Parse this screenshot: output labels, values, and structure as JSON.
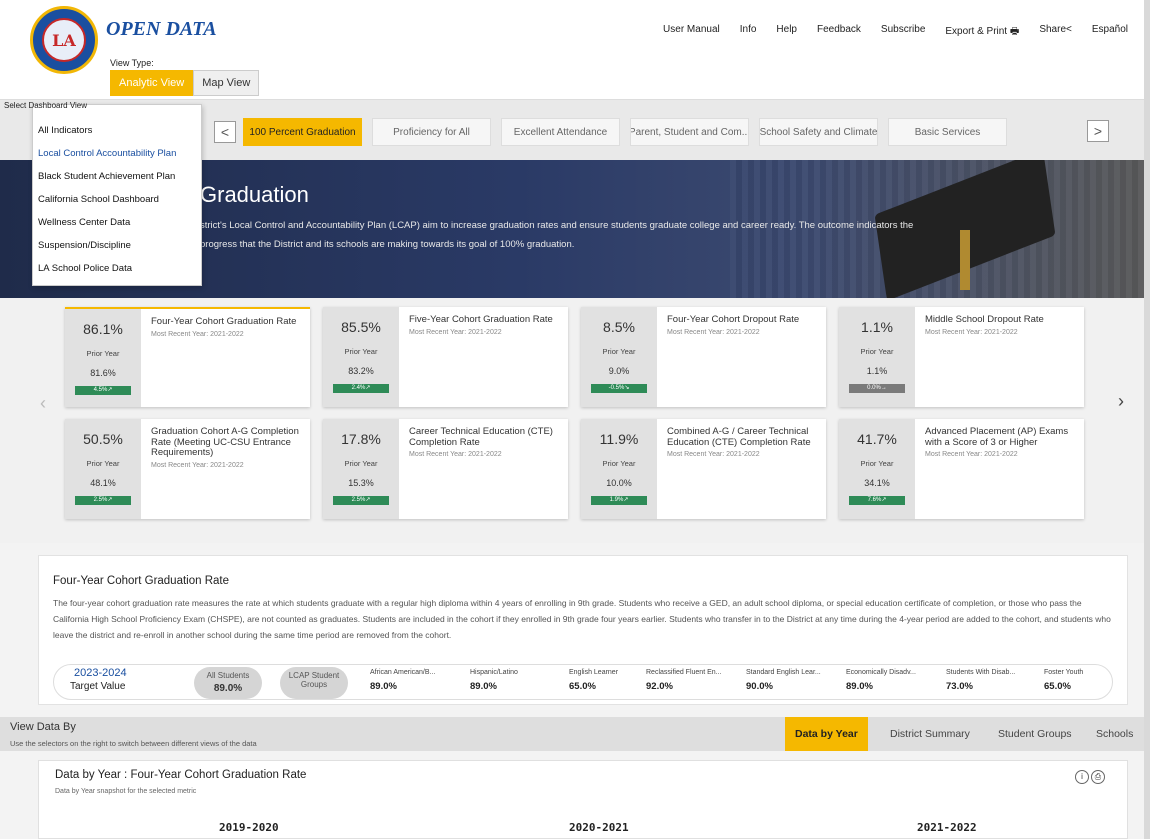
{
  "header": {
    "brand": "OPEN DATA",
    "logo_text": "LA",
    "nav": [
      "User Manual",
      "Info",
      "Help",
      "Feedback",
      "Subscribe",
      "Export & Print",
      "Share",
      "Español"
    ],
    "view_type_label": "View Type:",
    "view_tabs": [
      "Analytic View",
      "Map View"
    ]
  },
  "selector": {
    "label": "Select Dashboard View",
    "prev": "<",
    "next": ">",
    "tabs": [
      "100 Percent Graduation",
      "Proficiency for All",
      "Excellent Attendance",
      "Parent, Student and Com...",
      "School Safety and Climate",
      "Basic Services"
    ]
  },
  "dropdown": {
    "items": [
      "All Indicators",
      "Local Control Accountability Plan",
      "Black Student Achievement Plan",
      "California School Dashboard",
      "Wellness Center Data",
      "Suspension/Discipline",
      "LA School Police Data"
    ],
    "selected": "Local Control Accountability Plan"
  },
  "hero": {
    "title": "Graduation",
    "text": "strict's Local Control and Accountability Plan (LCAP) aim to increase graduation rates and ensure students graduate college and career ready. The outcome indicators the progress that the District and its schools are making towards its goal of 100% graduation."
  },
  "cards": [
    {
      "value": "86.1%",
      "prior_label": "Prior Year",
      "prior": "81.6%",
      "change": "4.5%↗",
      "title": "Four-Year Cohort Graduation Rate",
      "recent": "Most Recent Year: 2021-2022"
    },
    {
      "value": "85.5%",
      "prior_label": "Prior Year",
      "prior": "83.2%",
      "change": "2.4%↗",
      "title": "Five-Year Cohort Graduation Rate",
      "recent": "Most Recent Year: 2021-2022"
    },
    {
      "value": "8.5%",
      "prior_label": "Prior Year",
      "prior": "9.0%",
      "change": "-0.5%↘",
      "title": "Four-Year Cohort Dropout Rate",
      "recent": "Most Recent Year: 2021-2022"
    },
    {
      "value": "1.1%",
      "prior_label": "Prior Year",
      "prior": "1.1%",
      "change": "0.0%→",
      "title": "Middle School Dropout Rate",
      "recent": "Most Recent Year: 2021-2022"
    },
    {
      "value": "50.5%",
      "prior_label": "Prior Year",
      "prior": "48.1%",
      "change": "2.5%↗",
      "title": "Graduation Cohort A-G Completion Rate (Meeting UC-CSU Entrance Requirements)",
      "recent": "Most Recent Year: 2021-2022"
    },
    {
      "value": "17.8%",
      "prior_label": "Prior Year",
      "prior": "15.3%",
      "change": "2.5%↗",
      "title": "Career Technical Education (CTE) Completion Rate",
      "recent": "Most Recent Year: 2021-2022"
    },
    {
      "value": "11.9%",
      "prior_label": "Prior Year",
      "prior": "10.0%",
      "change": "1.9%↗",
      "title": "Combined A-G / Career Technical Education (CTE) Completion Rate",
      "recent": "Most Recent Year: 2021-2022"
    },
    {
      "value": "41.7%",
      "prior_label": "Prior Year",
      "prior": "34.1%",
      "change": "7.6%↗",
      "title": "Advanced Placement (AP) Exams with a Score of 3 or Higher",
      "recent": "Most Recent Year: 2021-2022"
    }
  ],
  "description": {
    "title": "Four-Year Cohort Graduation Rate",
    "text": "The four-year cohort graduation rate measures the rate at which students graduate with a regular high diploma within 4 years of enrolling in 9th grade. Students who receive a GED, an adult school diploma, or special education certificate of completion, or those who pass the California High School Proficiency Exam (CHSPE), are not counted as graduates. Students are included in the cohort if they enrolled in 9th grade four years earlier. Students who transfer in to the District at any time during the 4-year period are added to the cohort, and students who leave the district and re-enroll in another school during the same time period are removed from the cohort."
  },
  "target": {
    "year": "2023-2024",
    "label": "Target Value",
    "all_students_label": "All Students",
    "all_students_value": "89.0%",
    "lcap_label": "LCAP Student Groups",
    "groups": [
      {
        "name": "African American/B...",
        "value": "89.0%"
      },
      {
        "name": "Hispanic/Latino",
        "value": "89.0%"
      },
      {
        "name": "English Learner",
        "value": "65.0%"
      },
      {
        "name": "Reclassified Fluent En...",
        "value": "92.0%"
      },
      {
        "name": "Standard English Lear...",
        "value": "90.0%"
      },
      {
        "name": "Economically Disadv...",
        "value": "89.0%"
      },
      {
        "name": "Students With Disab...",
        "value": "73.0%"
      },
      {
        "name": "Foster Youth",
        "value": "65.0%"
      }
    ]
  },
  "view_by": {
    "title": "View Data By",
    "subtitle": "Use the selectors on the right to switch between different views of the data",
    "tabs": [
      "Data by Year",
      "District Summary",
      "Student Groups",
      "Schools"
    ]
  },
  "data_by_year": {
    "title": "Data by Year : Four-Year Cohort Graduation Rate",
    "subtitle": "Data by Year snapshot for the selected metric",
    "years": [
      "2019-2020",
      "2020-2021",
      "2021-2022"
    ]
  },
  "colors": {
    "accent": "#f5b800",
    "brand": "#1a4fa0",
    "positive": "#2e8b57",
    "neutral": "#7a7a7a"
  }
}
